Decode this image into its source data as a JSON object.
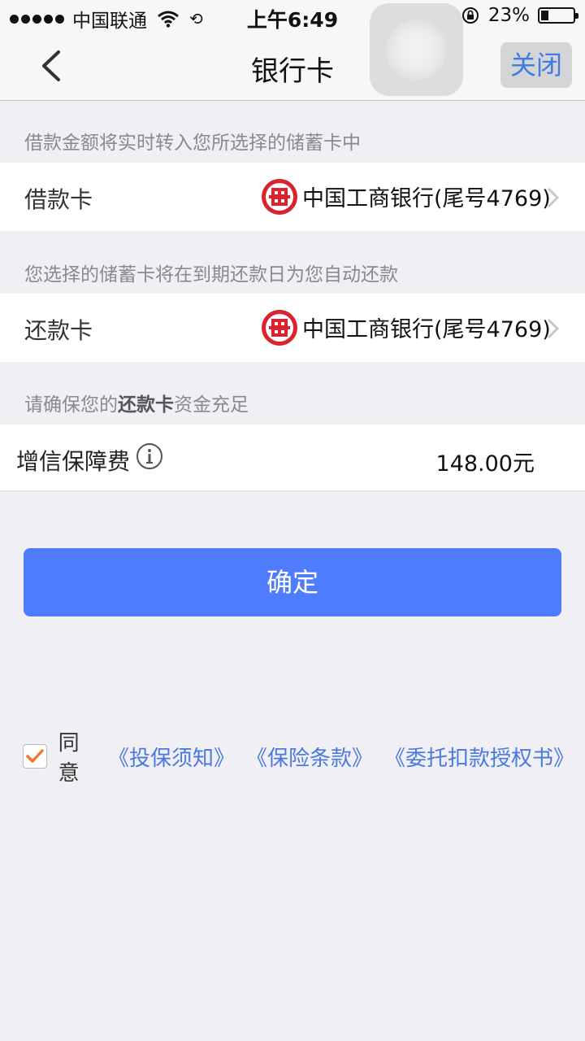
{
  "status_bar": {
    "carrier": "中国联通",
    "time": "上午6:49",
    "battery_percent": "23%",
    "battery_level": 0.23,
    "icons": [
      "signal-dots-icon",
      "wifi-icon",
      "sync-icon",
      "rotation-lock-icon",
      "battery-icon"
    ]
  },
  "nav": {
    "title": "银行卡",
    "close_label": "关闭",
    "back_icon": "chevron-left-icon"
  },
  "sections": {
    "loan_hint": "借款金额将实时转入您所选择的储蓄卡中",
    "loan_card": {
      "label": "借款卡",
      "bank": "中国工商银行(尾号4769)",
      "icon": "icbc-logo-icon"
    },
    "repay_hint": "您选择的储蓄卡将在到期还款日为您自动还款",
    "repay_card": {
      "label": "还款卡",
      "bank": "中国工商银行(尾号4769)",
      "icon": "icbc-logo-icon"
    },
    "ensure_hint": {
      "prefix": "请确保您的",
      "bold": "还款卡",
      "suffix": "资金充足"
    },
    "fee": {
      "label": "增信保障费",
      "value": "148.00元",
      "icon": "info-icon"
    }
  },
  "confirm_label": "确定",
  "agreement": {
    "checked": true,
    "agree_text": "同意",
    "links": [
      "《投保须知》",
      "《保险条款》",
      "《委托扣款授权书》"
    ]
  },
  "colors": {
    "primary_button": "#4f7cff",
    "link": "#4a7ae0",
    "check": "#f07a2a",
    "bank_red": "#d9232d"
  }
}
